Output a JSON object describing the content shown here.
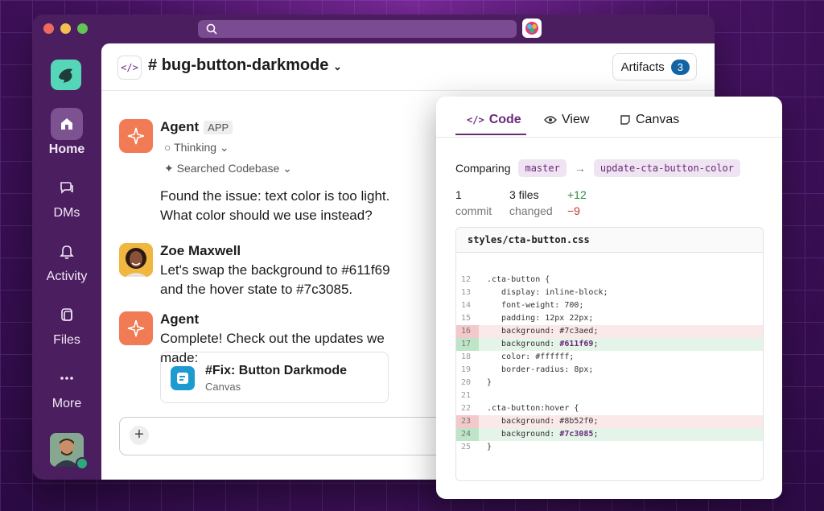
{
  "channel": {
    "name": "bug-button-darkmode",
    "artifacts_label": "Artifacts",
    "artifacts_count": "3"
  },
  "rail": {
    "items": [
      {
        "label": "Home",
        "icon": "home-icon"
      },
      {
        "label": "DMs",
        "icon": "dm-icon"
      },
      {
        "label": "Activity",
        "icon": "bell-icon"
      },
      {
        "label": "Files",
        "icon": "files-icon"
      },
      {
        "label": "More",
        "icon": "more-icon"
      }
    ]
  },
  "messages": {
    "agent1": {
      "name": "Agent",
      "tag": "APP",
      "thinking": "Thinking",
      "searched": "Searched Codebase",
      "line1": "Found the issue: text color is too light.",
      "line2": "What color should we use instead?"
    },
    "zoe": {
      "name": "Zoe Maxwell",
      "line1": "Let's swap the background to #611f69",
      "line2": "and the hover state to #7c3085."
    },
    "agent2": {
      "name": "Agent",
      "line1": "Complete! Check out the updates we made:",
      "card_title": "#Fix: Button Darkmode",
      "card_sub": "Canvas"
    }
  },
  "composer": {
    "plus": "+"
  },
  "panel": {
    "tabs": [
      {
        "label": "Code",
        "icon": "code-icon"
      },
      {
        "label": "View",
        "icon": "eye-icon"
      },
      {
        "label": "Canvas",
        "icon": "canvas-icon"
      }
    ],
    "comparing": "Comparing",
    "base": "master",
    "head": "update-cta-button-color",
    "commits": "1",
    "commits_label": "commit",
    "files": "3 files",
    "files_label": "changed",
    "added": "+12",
    "removed": "−9",
    "filename": "styles/cta-button.css"
  },
  "colors": {
    "brand": "#4b1f5f",
    "accent": "#6b2a7a",
    "agent": "#f07b54",
    "badge": "#1264a3"
  }
}
